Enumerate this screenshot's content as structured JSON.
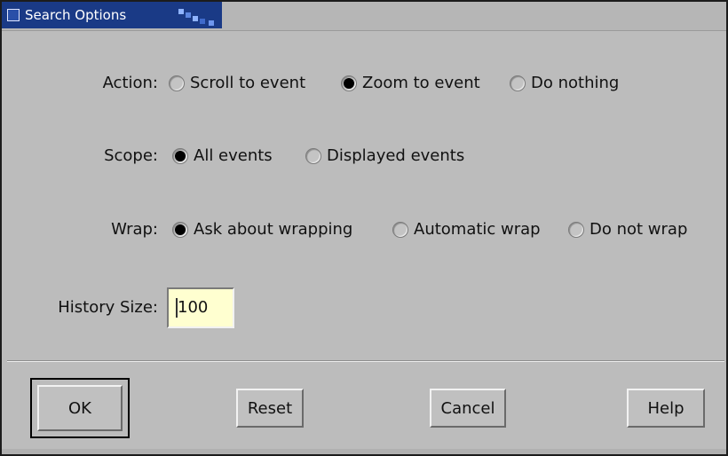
{
  "window": {
    "title": "Search Options"
  },
  "action": {
    "label": "Action:",
    "options": [
      {
        "label": "Scroll to event",
        "selected": false
      },
      {
        "label": "Zoom to event",
        "selected": true
      },
      {
        "label": "Do nothing",
        "selected": false
      }
    ]
  },
  "scope": {
    "label": "Scope:",
    "options": [
      {
        "label": "All events",
        "selected": true
      },
      {
        "label": "Displayed events",
        "selected": false
      }
    ]
  },
  "wrap": {
    "label": "Wrap:",
    "options": [
      {
        "label": "Ask about wrapping",
        "selected": true
      },
      {
        "label": "Automatic wrap",
        "selected": false
      },
      {
        "label": "Do not wrap",
        "selected": false
      }
    ]
  },
  "history": {
    "label": "History Size:",
    "value": "100"
  },
  "buttons": {
    "ok": "OK",
    "reset": "Reset",
    "cancel": "Cancel",
    "help": "Help"
  },
  "colors": {
    "title_bar": "#1a3a86",
    "field_background": "#ffffd0",
    "dialog_background": "#bcbcbc"
  }
}
